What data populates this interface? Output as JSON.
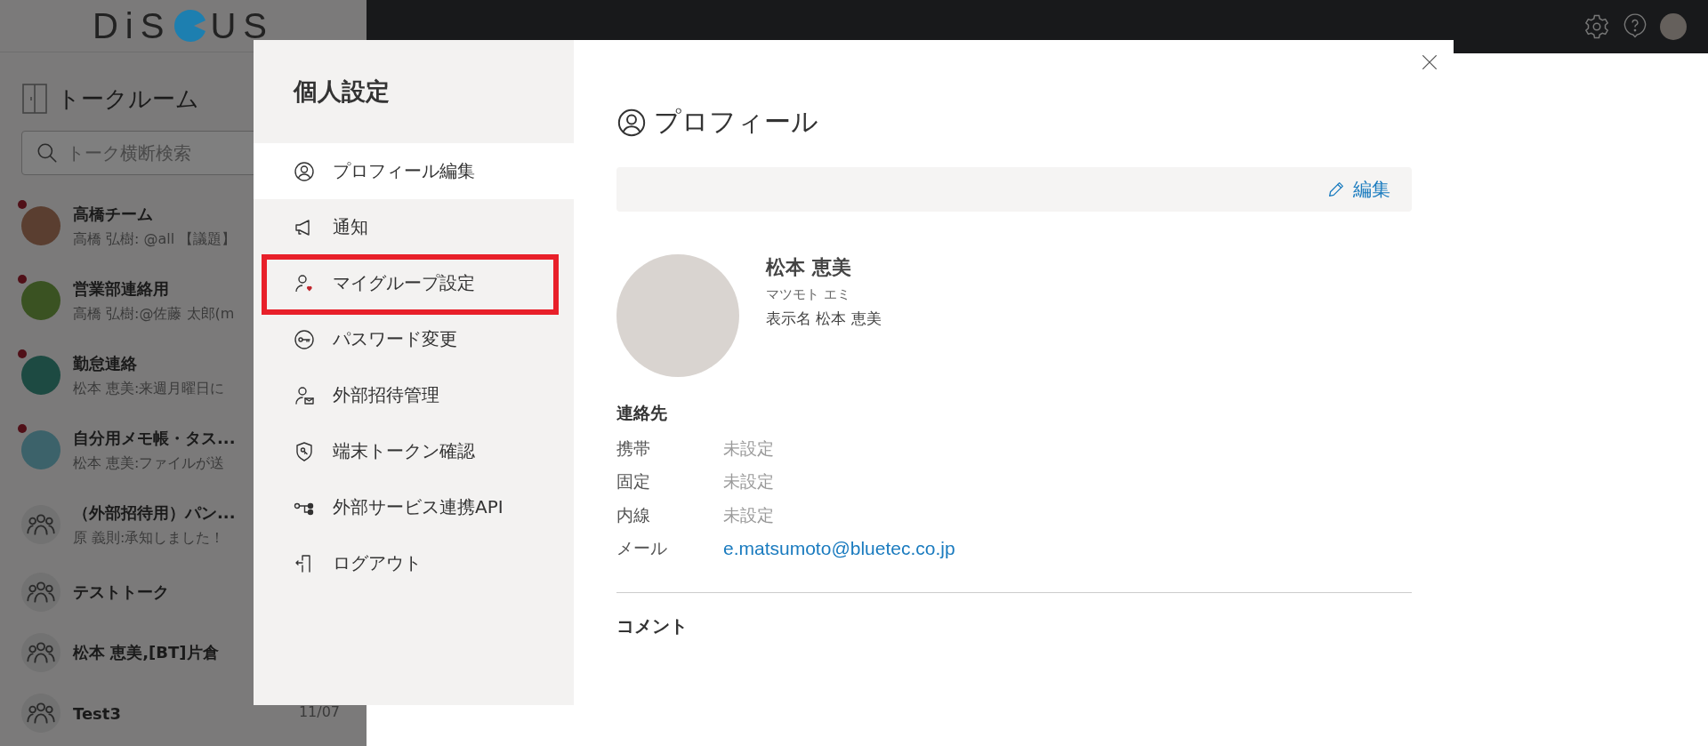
{
  "logo": {
    "before": "DiS",
    "after": "US"
  },
  "sidebar": {
    "title": "トークルーム",
    "search": {
      "placeholder": "トーク横断検索"
    },
    "talks": [
      {
        "name": "高橋チーム",
        "preview": "高橋 弘樹: @all 【議題】",
        "pinned": true,
        "kind": "image",
        "color": "#5a3e30"
      },
      {
        "name": "営業部連絡用",
        "preview": "高橋 弘樹:@佐藤 太郎(m",
        "pinned": true,
        "kind": "image",
        "color": "#3a5222"
      },
      {
        "name": "勤怠連絡",
        "preview": "松本 恵美:来週月曜日に",
        "pinned": true,
        "kind": "image",
        "color": "#1d4a42"
      },
      {
        "name": "自分用メモ帳・タス...",
        "preview": "松本 恵美:ファイルが送",
        "pinned": true,
        "kind": "image",
        "color": "#3c626a"
      },
      {
        "name": "（外部招待用）パン...",
        "preview": "原 義則:承知しました！",
        "pinned": false,
        "kind": "group"
      },
      {
        "name": "テストトーク",
        "pinned": false,
        "kind": "group"
      },
      {
        "name": "松本 恵美,[BT]片倉",
        "pinned": false,
        "kind": "group"
      },
      {
        "name": "Test3",
        "date": "11/07",
        "pinned": false,
        "kind": "group"
      }
    ]
  },
  "modal": {
    "title": "個人設定",
    "menu": [
      {
        "label": "プロフィール編集",
        "selected": true,
        "highlighted": false
      },
      {
        "label": "通知",
        "selected": false,
        "highlighted": false
      },
      {
        "label": "マイグループ設定",
        "selected": false,
        "highlighted": true
      },
      {
        "label": "パスワード変更",
        "selected": false,
        "highlighted": false
      },
      {
        "label": "外部招待管理",
        "selected": false,
        "highlighted": false
      },
      {
        "label": "端末トークン確認",
        "selected": false,
        "highlighted": false
      },
      {
        "label": "外部サービス連携API",
        "selected": false,
        "highlighted": false
      },
      {
        "label": "ログアウト",
        "selected": false,
        "highlighted": false
      }
    ],
    "profile": {
      "heading": "プロフィール",
      "edit_button": "編集",
      "name": "松本 恵美",
      "kana": "マツモト エミ",
      "display_name": "表示名 松本 恵美",
      "contact_heading": "連絡先",
      "contacts": [
        {
          "label": "携帯",
          "value": "未設定",
          "kind": "unset"
        },
        {
          "label": "固定",
          "value": "未設定",
          "kind": "unset"
        },
        {
          "label": "内線",
          "value": "未設定",
          "kind": "unset"
        },
        {
          "label": "メール",
          "value": "e.matsumoto@bluetec.co.jp",
          "kind": "link"
        }
      ],
      "comment_heading": "コメント"
    }
  }
}
